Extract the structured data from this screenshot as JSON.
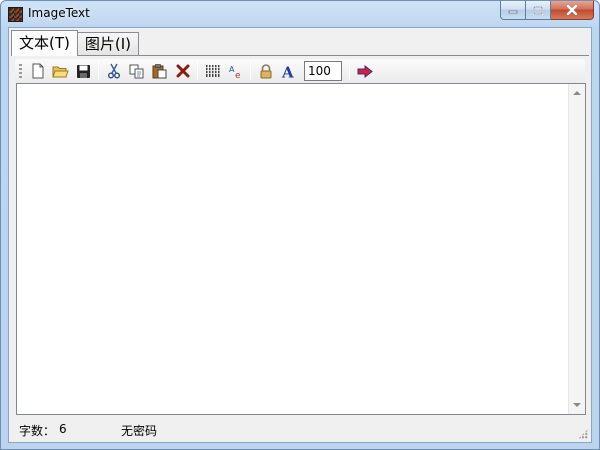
{
  "window": {
    "title": "ImageText",
    "app_icon": "app-icon"
  },
  "tabs": [
    {
      "label": "文本(T)",
      "active": true
    },
    {
      "label": "图片(I)",
      "active": false
    }
  ],
  "toolbar": {
    "zoom_value": "100",
    "icons": [
      "new-file-icon",
      "open-folder-icon",
      "save-icon",
      "cut-icon",
      "copy-icon",
      "paste-icon",
      "delete-icon",
      "grid-icon",
      "spellcheck-icon",
      "lock-icon",
      "font-icon",
      "arrow-right-icon"
    ]
  },
  "statusbar": {
    "count_label": "字数：",
    "count_value": "6",
    "password_status": "无密码"
  },
  "colors": {
    "frame": "#bcd4ee",
    "close_button": "#c04a2d",
    "client": "#f0f0f0"
  }
}
